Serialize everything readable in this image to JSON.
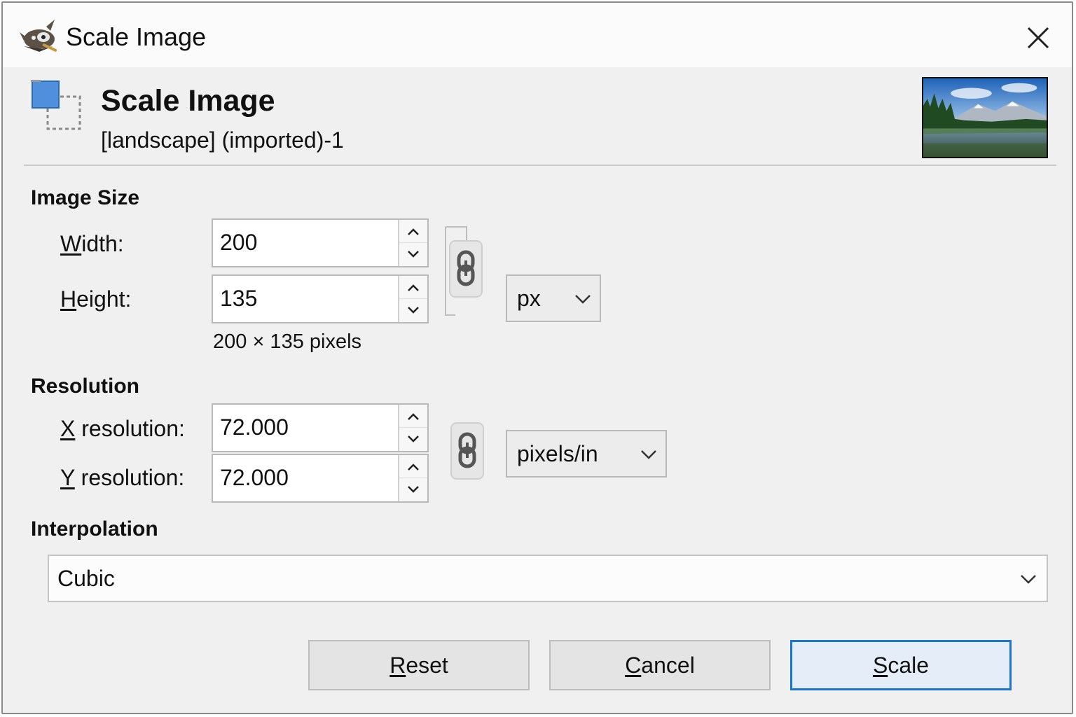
{
  "window": {
    "title": "Scale Image",
    "app_icon": "gimp-wilber-icon",
    "close_icon": "close-icon"
  },
  "header": {
    "title": "Scale Image",
    "subtitle": "[landscape] (imported)-1",
    "icon": "scale-image-icon",
    "thumbnail": "landscape-thumbnail"
  },
  "image_size": {
    "section_label": "Image Size",
    "width": {
      "label_mnemonic": "W",
      "label_rest": "idth:",
      "value": "200"
    },
    "height": {
      "label_mnemonic": "H",
      "label_rest": "eight:",
      "value": "135"
    },
    "unit": "px",
    "size_readout": "200 × 135 pixels",
    "chain_linked": true
  },
  "resolution": {
    "section_label": "Resolution",
    "x": {
      "label_mnemonic": "X",
      "label_rest": " resolution:",
      "value": "72.000"
    },
    "y": {
      "label_mnemonic": "Y",
      "label_rest": " resolution:",
      "value": "72.000"
    },
    "unit": "pixels/in",
    "chain_linked": true
  },
  "interpolation": {
    "section_label": "Interpolation",
    "value": "Cubic"
  },
  "buttons": {
    "reset": {
      "mnemonic": "R",
      "rest": "eset"
    },
    "cancel": {
      "mnemonic": "C",
      "rest": "ancel"
    },
    "scale": {
      "mnemonic": "S",
      "rest": "cale"
    }
  },
  "colors": {
    "accent": "#1a74d4",
    "dialog_bg": "#f0f0f0"
  }
}
